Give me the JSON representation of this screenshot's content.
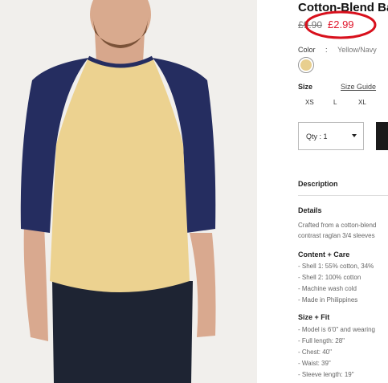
{
  "product": {
    "title": "Cotton-Blend Ba",
    "old_price": "£9.90",
    "new_price": "£2.99",
    "color_label": "Color",
    "color_sep": ":",
    "color_value": "Yellow/Navy",
    "size_label": "Size",
    "size_guide": "Size Guide",
    "sizes": [
      "XS",
      "L",
      "XL"
    ],
    "qty_label": "Qty : 1"
  },
  "description": {
    "heading": "Description",
    "details_heading": "Details",
    "details_lines": [
      "Crafted from a cotton-blend",
      "contrast raglan 3/4 sleeves"
    ],
    "content_heading": "Content + Care",
    "content_lines": [
      "- Shell 1: 55% cotton, 34%",
      "- Shell 2: 100% cotton",
      "- Machine wash cold",
      "- Made in Philippines"
    ],
    "fit_heading": "Size + Fit",
    "fit_lines": [
      "- Model is 6'0\" and wearing",
      "- Full length: 28\"",
      "- Chest: 40\"",
      "- Waist: 39\"",
      "- Sleeve length: 19\""
    ]
  },
  "colors": {
    "price_red": "#e0162b",
    "annotation_red": "#d8101c",
    "shirt_body": "#ecd290",
    "shirt_sleeves": "#252d60",
    "swatch": "#e8cf8f"
  }
}
